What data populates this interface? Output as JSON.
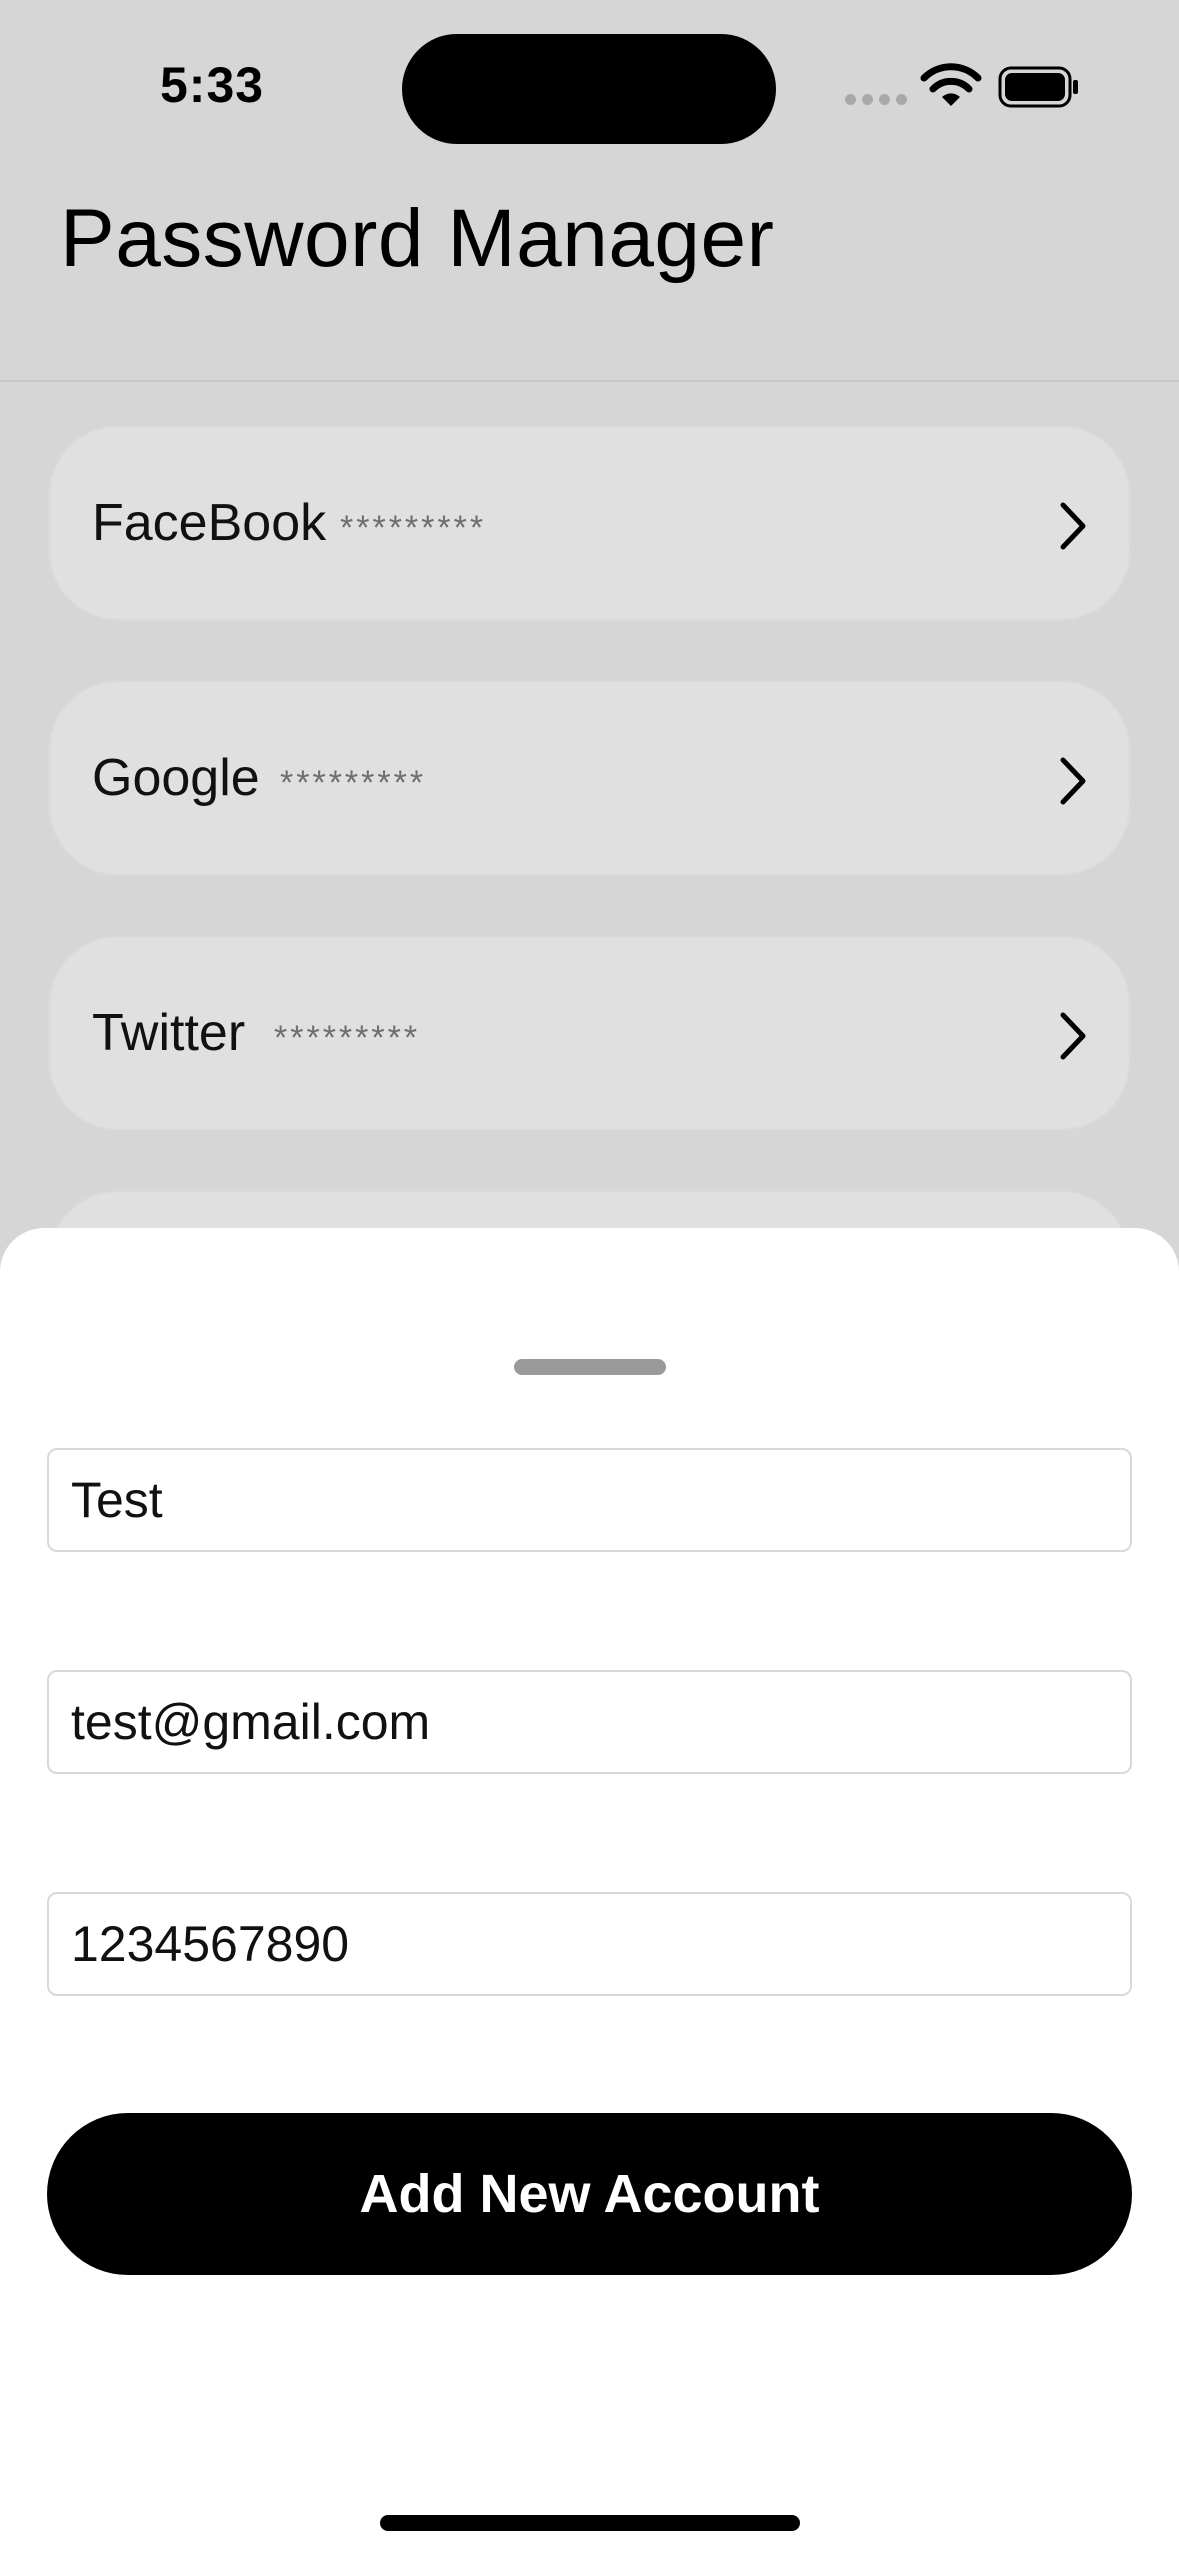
{
  "status_bar": {
    "time": "5:33"
  },
  "header": {
    "title": "Password Manager"
  },
  "accounts": [
    {
      "name": "FaceBook",
      "masked_password": "*********"
    },
    {
      "name": "Google",
      "masked_password": "*********"
    },
    {
      "name": "Twitter",
      "masked_password": "*********"
    }
  ],
  "sheet": {
    "fields": [
      {
        "value": "Test"
      },
      {
        "value": "test@gmail.com"
      },
      {
        "value": "1234567890"
      }
    ],
    "submit_label": "Add New Account"
  }
}
